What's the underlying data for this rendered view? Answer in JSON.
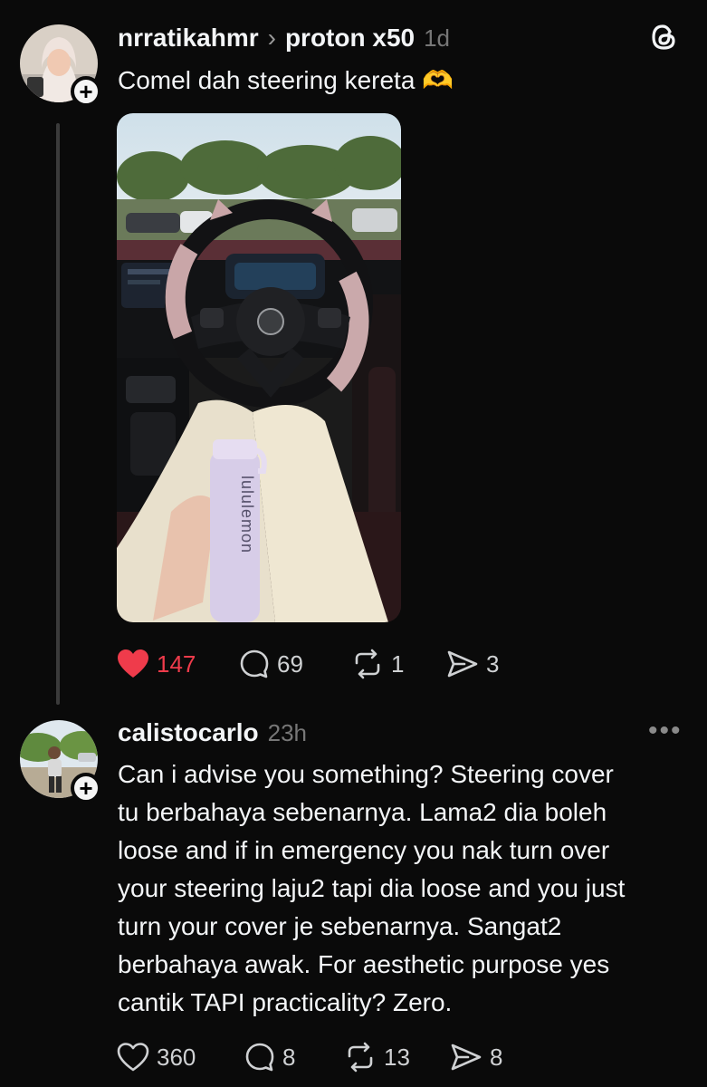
{
  "post": {
    "username": "nrratikahmr",
    "community": "proton x50",
    "time": "1d",
    "text": "Comel dah steering kereta 🫶",
    "brand_icon": "threads-icon",
    "stats": {
      "likes": "147",
      "comments": "69",
      "reposts": "1",
      "shares": "3"
    }
  },
  "reply": {
    "username": "calistocarlo",
    "time": "23h",
    "lines": [
      "Can i advise you something? Steering cover",
      "tu berbahaya sebenarnya. Lama2 dia boleh",
      "loose and if in emergency you nak turn over",
      "your steering laju2 tapi dia loose and you just",
      "turn your cover je sebenarnya. Sangat2",
      "berbahaya awak. For aesthetic purpose yes",
      "cantik TAPI practicality? Zero."
    ],
    "stats": {
      "likes": "360",
      "comments": "8",
      "reposts": "13",
      "shares": "8"
    }
  },
  "colors": {
    "background": "#0a0a0a",
    "like_red": "#ef3b4b",
    "thread_line": "#3b3b3b"
  }
}
